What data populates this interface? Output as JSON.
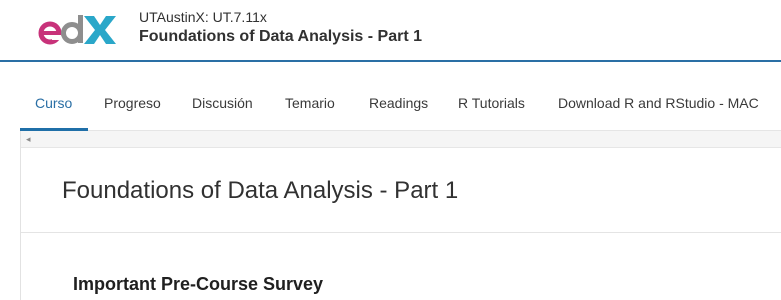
{
  "header": {
    "logo_name": "edX",
    "course_org": "UTAustinX: UT.7.11x",
    "course_title": "Foundations of Data Analysis - Part 1",
    "brand_colors": {
      "e": "#c8327a",
      "d": "#c8327a",
      "X": "#2aa7c9",
      "border": "#2a6fa5"
    }
  },
  "tabs": [
    {
      "label": "Curso",
      "active": true
    },
    {
      "label": "Progreso",
      "active": false
    },
    {
      "label": "Discusión",
      "active": false
    },
    {
      "label": "Temario",
      "active": false
    },
    {
      "label": "Readings",
      "active": false
    },
    {
      "label": "R Tutorials",
      "active": false
    },
    {
      "label": "Download R and RStudio - MAC",
      "active": false
    }
  ],
  "content": {
    "scroll_left_icon": "◂",
    "unit_title": "Foundations of Data Analysis - Part 1",
    "section_heading": "Important Pre-Course Survey"
  }
}
